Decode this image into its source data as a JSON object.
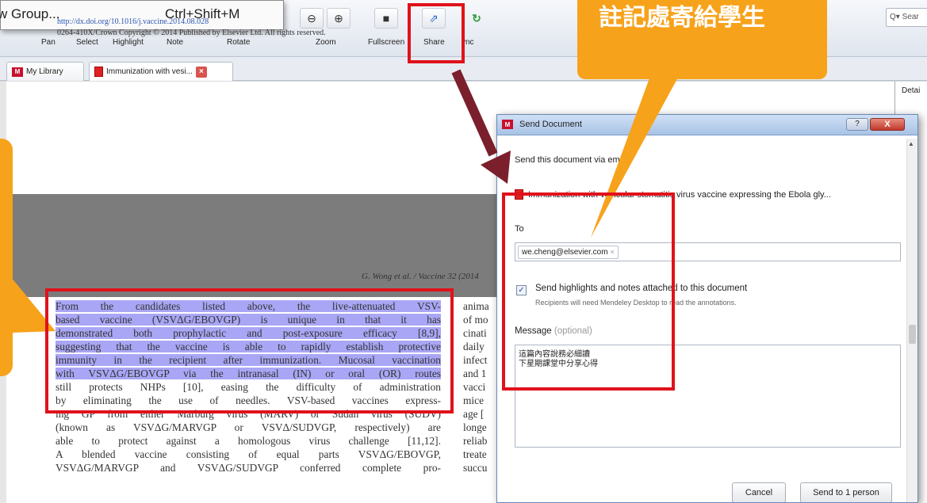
{
  "menu": {
    "label": "w Group...",
    "shortcut": "Ctrl+Shift+M"
  },
  "toolbar": {
    "buttons": [
      {
        "label": "Pan"
      },
      {
        "label": "Select"
      },
      {
        "label": "Highlight"
      },
      {
        "label": "Note"
      },
      {
        "label": "Rotate"
      },
      {
        "label": "Zoom"
      },
      {
        "label": "Fullscreen"
      },
      {
        "label": "Share"
      },
      {
        "label": "ync"
      }
    ],
    "search_placeholder": "Sear"
  },
  "tabs": [
    {
      "label": "My Library"
    },
    {
      "label": "Immunization with vesi..."
    }
  ],
  "pdf": {
    "doi": "http://dx.doi.org/10.1016/j.vaccine.2014.08.028",
    "copyright": "0264-410X/Crown Copyright © 2014 Published by Elsevier Ltd. All rights reserved.",
    "running_head": "G. Wong et al. / Vaccine 32 (2014",
    "left_lines": [
      "From the candidates listed above, the live-attenuated VSV-",
      "based vaccine (VSVΔG/EBOVGP) is unique in that it has",
      "demonstrated both prophylactic and post-exposure efficacy [8,9],",
      "suggesting that the vaccine is able to rapidly establish protective",
      "immunity in the recipient after immunization. Mucosal vaccination",
      "with VSVΔG/EBOVGP via the intranasal (IN) or oral (OR) routes",
      "still protects NHPs [10], easing the difficulty of administration",
      "by eliminating the use of needles. VSV-based vaccines express-",
      "ing GP from either Marburg virus (MARV) or Sudan virus (SUDV)",
      "(known as VSVΔG/MARVGP or VSVΔ/SUDVGP, respectively) are",
      "able to protect against a homologous virus challenge [11,12].",
      "A blended vaccine consisting of equal parts VSVΔG/EBOVGP,",
      "VSVΔG/MARVGP and VSVΔG/SUDVGP conferred complete pro-"
    ],
    "right_lines": [
      "anima",
      "of mo",
      "cinati",
      "daily",
      "infect",
      "and 1",
      "vacci",
      "mice",
      "age [",
      "longe",
      "reliab",
      "treate",
      "succu"
    ]
  },
  "details_tab": "Detai",
  "dialog": {
    "title": "Send Document",
    "heading": "Send this document via email",
    "document_name": "Immunization with vesicular stomatitis virus vaccine expressing the Ebola gly...",
    "to_label": "To",
    "recipient": "we.cheng@elsevier.com",
    "send_highlights_label": "Send highlights and notes attached to this document",
    "send_highlights_sub": "Recipients will need Mendeley Desktop to read the annotations.",
    "send_highlights_checked": true,
    "message_label": "Message",
    "message_optional": "(optional)",
    "message_body": "這篇內容說務必細讀\n下星期課堂中分享心得",
    "cancel": "Cancel",
    "send": "Send to 1 person",
    "help": "?",
    "close": "X"
  },
  "annotations": {
    "callout_text": "註記處寄給學生",
    "accent_color": "#f7a21b",
    "box_color": "#e0121b",
    "arrow_color": "#7a1f2b"
  }
}
